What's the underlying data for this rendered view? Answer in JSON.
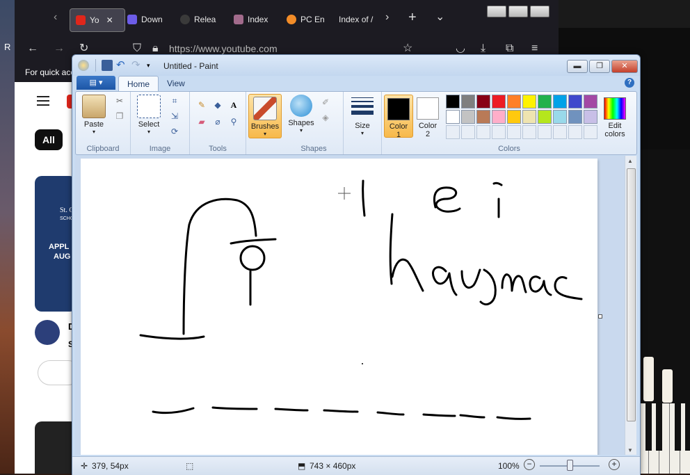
{
  "browser": {
    "tabs": [
      {
        "label": "Yo",
        "active": true,
        "favicon_color": "#e0261b",
        "icon": "youtube-icon"
      },
      {
        "label": "Down",
        "active": false,
        "favicon_color": "#6c5ce7",
        "icon": "download-site-icon"
      },
      {
        "label": "Relea",
        "active": false,
        "favicon_color": "#3a3a3a",
        "icon": "github-icon"
      },
      {
        "label": "Index",
        "active": false,
        "favicon_color": "#a26b8c",
        "icon": "index-site-icon"
      },
      {
        "label": "PC En",
        "active": false,
        "favicon_color": "#f28c28",
        "icon": "pc-site-icon"
      },
      {
        "label": "Index of /",
        "active": false,
        "favicon_color": "",
        "icon": ""
      }
    ],
    "url": "https://www.youtube.com",
    "bookmark_hint": "For quick acc",
    "page": {
      "chip_all": "All",
      "ad_title": "St. G",
      "ad_subtitle": "SCHO",
      "ad_text_1": "APPL",
      "ad_text_2": "AUG",
      "channel_initial": "D",
      "channel_sub": "S"
    },
    "left_edge_text": "R"
  },
  "paint": {
    "title": "Untitled - Paint",
    "tabs": {
      "home": "Home",
      "view": "View"
    },
    "groups": {
      "clipboard": {
        "label": "Clipboard",
        "paste": "Paste"
      },
      "image": {
        "label": "Image",
        "select": "Select"
      },
      "tools": {
        "label": "Tools"
      },
      "brushes": {
        "label": "Brushes"
      },
      "shapes": {
        "label": "Shapes",
        "shapes_btn": "Shapes"
      },
      "size": {
        "label": "Size"
      },
      "colors": {
        "label": "Colors",
        "color1": "Color\n1",
        "color1_line1": "Color",
        "color1_line2": "1",
        "color2_line1": "Color",
        "color2_line2": "2",
        "edit_colors_line1": "Edit",
        "edit_colors_line2": "colors",
        "color1_value": "#000000",
        "color2_value": "#ffffff",
        "palette_row1": [
          "#000000",
          "#7f7f7f",
          "#880015",
          "#ed1c24",
          "#ff7f27",
          "#fff200",
          "#22b14c",
          "#00a2e8",
          "#3f48cc",
          "#a349a4"
        ],
        "palette_row2": [
          "#ffffff",
          "#c3c3c3",
          "#b97a57",
          "#ffaec9",
          "#ffc90e",
          "#efe4b0",
          "#b5e61d",
          "#99d9ea",
          "#7092be",
          "#c8bfe7"
        ]
      }
    },
    "status": {
      "cursor_pos": "379, 54px",
      "canvas_size": "743 × 460px",
      "zoom": "100%"
    }
  }
}
